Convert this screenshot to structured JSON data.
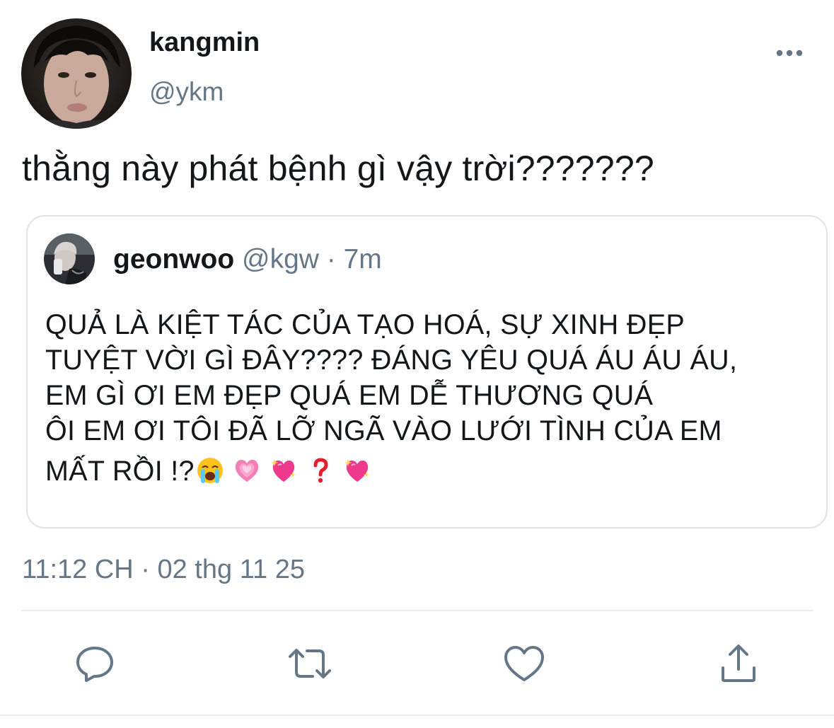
{
  "tweet": {
    "author_name": "kangmin",
    "author_handle": "@ykm",
    "text": "thằng này phát bệnh gì vậy trời???????",
    "timestamp": "11:12 CH · 02 thg 11 25"
  },
  "quoted_tweet": {
    "author_name": "geonwoo",
    "meta": "@kgw · 7m",
    "lines": [
      "QUẢ LÀ KIỆT TÁC CỦA TẠO HOÁ, SỰ XINH ĐẸP",
      "TUYỆT VỜI GÌ ĐÂY???? ĐÁNG YÊU QUÁ ÁU ÁU ÁU,",
      "EM GÌ ƠI EM ĐẸP QUÁ EM DỄ THƯƠNG QUÁ",
      "ÔI EM ƠI TÔI ĐÃ LỠ NGÃ VÀO LƯỚI TÌNH CỦA EM"
    ],
    "last_line": "MẤT RỒI !?",
    "emojis": [
      "loudly-crying-face",
      "growing-heart",
      "sparkling-heart",
      "red-question-mark",
      "sparkling-heart"
    ]
  },
  "actions": [
    "reply-icon",
    "retweet-icon",
    "like-icon",
    "share-icon"
  ],
  "colors": {
    "text_primary": "#14171a",
    "text_secondary": "#657786",
    "border": "#dde3e8",
    "icon": "#657786"
  }
}
